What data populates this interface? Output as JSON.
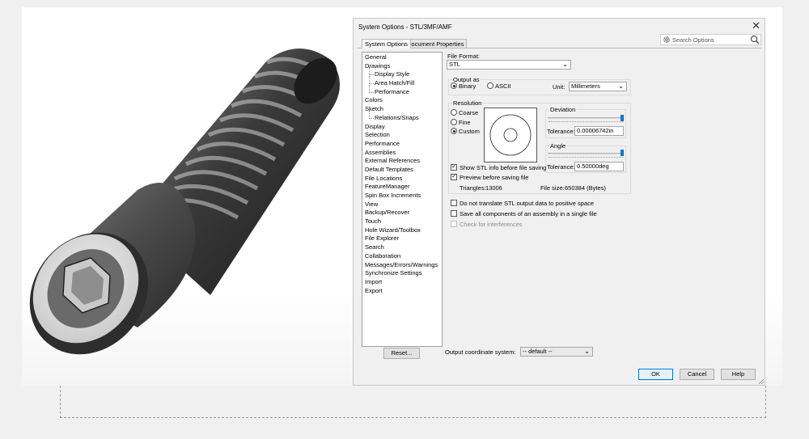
{
  "dialog": {
    "title": "System Options - STL/3MF/AMF",
    "close_glyph": "✕",
    "tabs": [
      "System Options",
      "Document Properties"
    ],
    "search_placeholder": "Search Options"
  },
  "nav": {
    "items": [
      {
        "label": "General",
        "sub": false
      },
      {
        "label": "Drawings",
        "sub": false
      },
      {
        "label": "Display Style",
        "sub": true
      },
      {
        "label": "Area Hatch/Fill",
        "sub": true
      },
      {
        "label": "Performance",
        "sub": true
      },
      {
        "label": "Colors",
        "sub": false
      },
      {
        "label": "Sketch",
        "sub": false
      },
      {
        "label": "Relations/Snaps",
        "sub": true
      },
      {
        "label": "Display",
        "sub": false
      },
      {
        "label": "Selection",
        "sub": false
      },
      {
        "label": "Performance",
        "sub": false
      },
      {
        "label": "Assemblies",
        "sub": false
      },
      {
        "label": "External References",
        "sub": false
      },
      {
        "label": "Default Templates",
        "sub": false
      },
      {
        "label": "File Locations",
        "sub": false
      },
      {
        "label": "FeatureManager",
        "sub": false
      },
      {
        "label": "Spin Box Increments",
        "sub": false
      },
      {
        "label": "View",
        "sub": false
      },
      {
        "label": "Backup/Recover",
        "sub": false
      },
      {
        "label": "Touch",
        "sub": false
      },
      {
        "label": "Hole Wizard/Toolbox",
        "sub": false
      },
      {
        "label": "File Explorer",
        "sub": false
      },
      {
        "label": "Search",
        "sub": false
      },
      {
        "label": "Collaboration",
        "sub": false
      },
      {
        "label": "Messages/Errors/Warnings",
        "sub": false
      },
      {
        "label": "Synchronize Settings",
        "sub": false
      },
      {
        "label": "Import",
        "sub": false
      },
      {
        "label": "Export",
        "sub": false
      }
    ],
    "reset_label": "Reset..."
  },
  "options": {
    "file_format_label": "File Format:",
    "file_format_value": "STL",
    "output_as_label": "Output as",
    "binary_label": "Binary",
    "ascii_label": "ASCII",
    "unit_label": "Unit:",
    "unit_value": "Millimeters",
    "resolution_label": "Resolution",
    "coarse_label": "Coarse",
    "fine_label": "Fine",
    "custom_label": "Custom",
    "deviation_label": "Deviation",
    "deviation_tolerance_label": "Tolerance:",
    "deviation_tolerance_value": "0.00006742in",
    "angle_label": "Angle",
    "angle_tolerance_label": "Tolerance:",
    "angle_tolerance_value": "0.50000deg",
    "show_info_label": "Show STL info before file saving",
    "preview_label": "Preview before saving file",
    "triangles_label": "Triangles:",
    "triangles_value": "13006",
    "file_size_label": "File size:",
    "file_size_value": "650384 (Bytes)",
    "no_translate_label": "Do not translate STL output data to positive space",
    "save_all_label": "Save all components of an assembly in a single file",
    "interference_label": "Check for interferences",
    "coord_label": "Output coordinate system:",
    "coord_value": "-- default --",
    "check_glyph": "✓",
    "chevron_glyph": "⌄"
  },
  "buttons": {
    "ok": "OK",
    "cancel": "Cancel",
    "help": "Help"
  }
}
